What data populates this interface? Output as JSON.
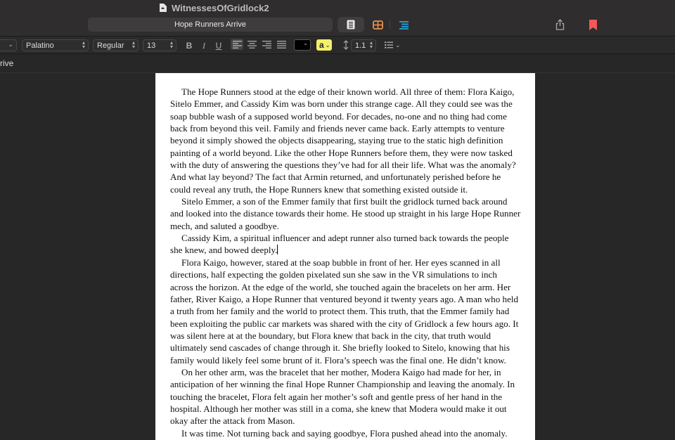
{
  "window": {
    "app_title": "WitnessesOfGridlock2",
    "document_title": "Hope Runners Arrive"
  },
  "toolbar": {
    "view_buttons": [
      {
        "name": "page-view",
        "icon": "document-icon",
        "active": true
      },
      {
        "name": "grid-view",
        "icon": "grid-icon",
        "color": "#e8904a"
      },
      {
        "name": "outline-view",
        "icon": "outline-list-icon",
        "color": "#2a9fd6"
      }
    ],
    "share_icon": "share-icon",
    "bookmark_icon": "bookmark-icon",
    "bookmark_color": "#f0585a"
  },
  "format_bar": {
    "style_select": "",
    "font_family": "Palatino",
    "font_style": "Regular",
    "font_size": "13",
    "bold_label": "B",
    "italic_label": "I",
    "underline_label": "U",
    "alignment": "left",
    "text_color": "#000000",
    "highlight_label": "a",
    "highlight_color": "#f5f06a",
    "line_spacing": "1.1",
    "list_icon": "bulleted-list-icon"
  },
  "section": {
    "label": "rrive"
  },
  "document": {
    "paragraphs": [
      "The Hope Runners stood at the edge of their known world. All three of them: Flora Kaigo, Sitelo Emmer, and Cassidy Kim was born under this strange cage. All they could see was the soap bubble wash of a supposed world beyond. For decades, no-one and no thing had come back from beyond this veil. Family and friends never came back. Early attempts to venture beyond it simply showed the objects disappearing, staying true to the static high definition painting of a world beyond. Like the other Hope Runners before them, they were now tasked with the duty of answering the questions they’ve had for all their life. What was the anomaly? And what lay beyond? The fact that Armin returned, and unfortunately perished before he could reveal any truth, the Hope Runners knew that something existed outside it.",
      "Sitelo Emmer, a son of the Emmer family that first built the gridlock turned back around and looked into the distance towards their home. He stood up straight in his large Hope Runner mech, and saluted a goodbye.",
      "Cassidy Kim, a spiritual influencer and adept runner also turned back towards the people she knew, and bowed deeply.",
      "Flora Kaigo, however, stared at the soap bubble in front of her. Her eyes scanned in all directions, half expecting the golden pixelated sun she saw in the VR simulations to inch across the horizon. At the edge of the world, she touched again the bracelets on her arm. Her father, River Kaigo, a Hope Runner that ventured beyond it twenty years ago. A man who held a truth from her family and the world to protect them. This truth, that the Emmer family had been exploiting the public car markets was shared with the city of Gridlock a few hours ago. It was silent here at at the boundary, but Flora knew that back in the city, that truth would ultimately send cascades of change through it. She briefly looked to Sitelo, knowing that his family would likely feel some brunt of it. Flora’s speech was the final one. He didn’t know.",
      "On her other arm, was the bracelet that her mother, Modera Kaigo had made for her, in anticipation of her winning the final Hope Runner Championship and leaving the anomaly. In touching the bracelet, Flora felt again her mother’s soft and gentle press of her hand in the hospital. Although her mother was still in a coma, she knew that Modera would make it out okay after the attack from Mason.",
      "It was time. Not turning back and saying goodbye, Flora pushed ahead into the anomaly."
    ]
  }
}
